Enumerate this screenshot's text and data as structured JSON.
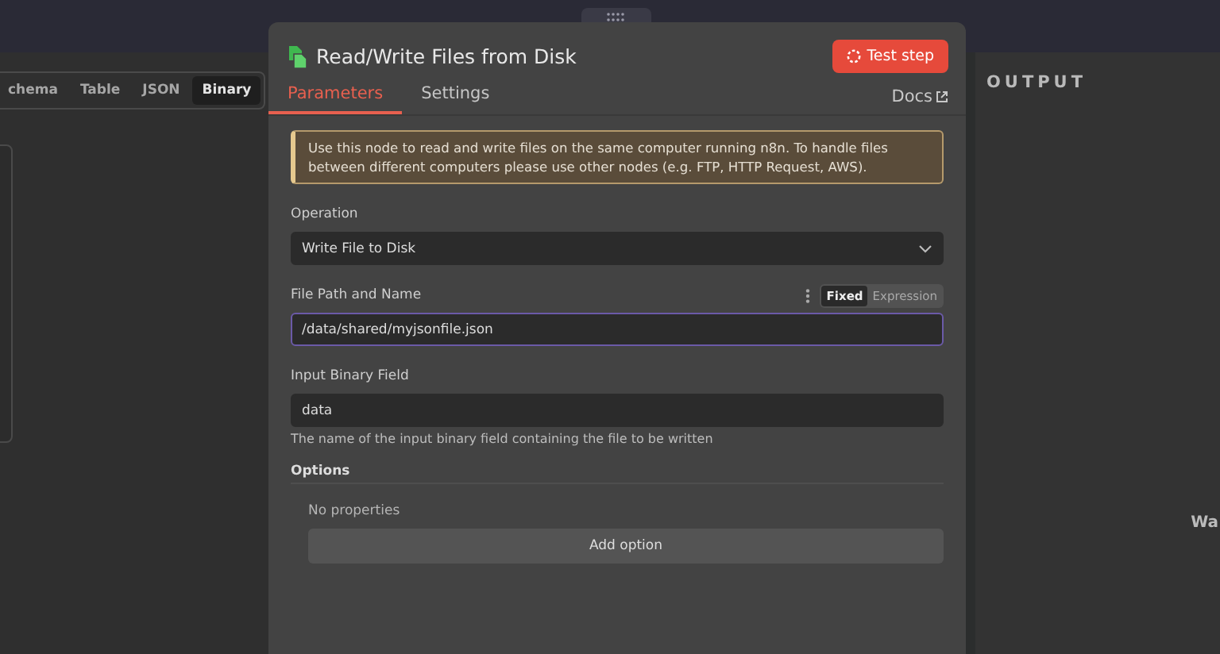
{
  "input_panel": {
    "tabs": [
      {
        "label": "chema",
        "selected": false
      },
      {
        "label": "Table",
        "selected": false
      },
      {
        "label": "JSON",
        "selected": false
      },
      {
        "label": "Binary",
        "selected": true
      }
    ]
  },
  "output_panel": {
    "title": "OUTPUT",
    "hint": "Wa"
  },
  "node_dialog": {
    "title": "Read/Write Files from Disk",
    "test_button": "Test step",
    "tabs": [
      {
        "label": "Parameters",
        "selected": true
      },
      {
        "label": "Settings",
        "selected": false
      }
    ],
    "docs_link": "Docs",
    "notice": "Use this node to read and write files on the same computer running n8n. To handle files between different computers please use other nodes (e.g. FTP, HTTP Request, AWS).",
    "parameters": [
      {
        "kind": "select",
        "label": "Operation",
        "value": "Write File to Disk"
      },
      {
        "kind": "text",
        "label": "File Path and Name",
        "value": "/data/shared/myjsonfile.json",
        "focused": true,
        "modes": [
          {
            "label": "Fixed",
            "selected": true
          },
          {
            "label": "Expression",
            "selected": false
          }
        ]
      },
      {
        "kind": "text",
        "label": "Input Binary Field",
        "value": "data",
        "focused": false,
        "hint": "The name of the input binary field containing the file to be written"
      }
    ],
    "options": {
      "title": "Options",
      "empty_text": "No properties",
      "add_button": "Add option"
    }
  }
}
